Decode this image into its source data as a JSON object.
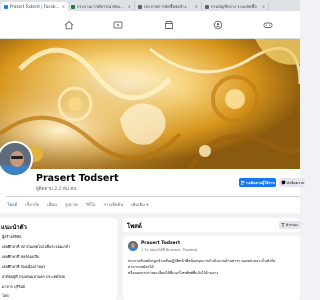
{
  "browser": {
    "tabs": [
      {
        "title": "Prasert Todsert | Facebook",
        "favicon_color": "#1877f2",
        "active": true
      },
      {
        "title": "กระบวนการพิจารณาคัดเลือก",
        "favicon_color": "#188038",
        "active": false
      },
      {
        "title": "ประกาศการจัดซื้อจัดจ้าง",
        "favicon_color": "#5f6368",
        "active": false
      },
      {
        "title": "กรมบัญชีกลาง ระบบจัดซื้อ",
        "favicon_color": "#5f6368",
        "active": false
      }
    ],
    "close_glyph": "×"
  },
  "profile": {
    "name": "Prasert Todsert",
    "followers": "ผู้ติดตาม 2.2 พัน คน",
    "follow_label": "กดติดตามผู้ใช้งาน",
    "message_label": "ส่งข้อความ",
    "tabs": [
      "โพสต์",
      "เกี่ยวกับ",
      "เพื่อน",
      "รูปภาพ",
      "วิดีโอ",
      "การเช็คอิน",
      "เพิ่มเติม"
    ],
    "active_tab": 0,
    "more_glyph": "▾"
  },
  "intro": {
    "title": "แนะนำตัว",
    "rows": [
      {
        "text": "ผู้สร้างดิจิทัล"
      },
      {
        "text": "เคยศึกษาที่ สถาบันเทคโนโลยีพระจอมเกล้า"
      },
      {
        "text": "เคยศึกษาที่ ฟอร์ตเอเลีย"
      },
      {
        "text": "เคยศึกษาที่ ร่องเมืองสายพร"
      },
      {
        "text": "อาศัยอยู่ที่ กรุงเทพมหานคร ประเทศไทย"
      },
      {
        "text": "มาจาก บุรีรัมย์"
      },
      {
        "text": "โสด"
      }
    ]
  },
  "posts": {
    "title": "โพสต์",
    "filter_label": "ตัวกรอง",
    "post": {
      "author": "Prasert Todsert",
      "meta": "สมัครได้ที่ Buriram, Thailand",
      "time": "1 วัน",
      "lines": [
        "ประกาศรับสมัครลูกจ้างเพื่อปฏิบัติหน้าที่สนับสนุนการดำเนินงานด้านต่างๆ ของหน่วยงานในสังกัด",
        "สามารถสมัครได้",
        "หรือสอบถามรายละเอียดได้ที่เบอร์โทรศัพท์ที่แจ้งไว้ด้านล่าง"
      ]
    }
  },
  "colors": {
    "accent": "#1877f2",
    "cover_gold": "#e9b632"
  }
}
